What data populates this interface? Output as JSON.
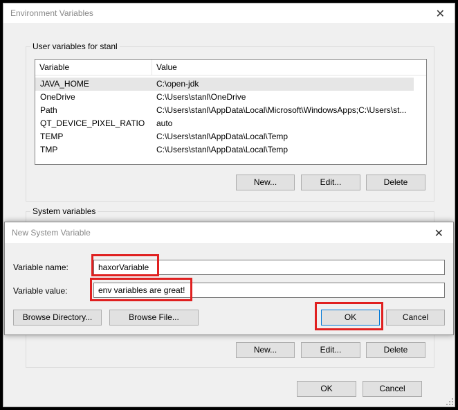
{
  "env_dialog": {
    "title": "Environment Variables",
    "close_glyph": "✕",
    "user_group_label": "User variables for stanl",
    "columns": [
      "Variable",
      "Value"
    ],
    "user_vars": [
      {
        "name": "JAVA_HOME",
        "value": "C:\\open-jdk"
      },
      {
        "name": "OneDrive",
        "value": "C:\\Users\\stanl\\OneDrive"
      },
      {
        "name": "Path",
        "value": "C:\\Users\\stanl\\AppData\\Local\\Microsoft\\WindowsApps;C:\\Users\\st..."
      },
      {
        "name": "QT_DEVICE_PIXEL_RATIO",
        "value": "auto"
      },
      {
        "name": "TEMP",
        "value": "C:\\Users\\stanl\\AppData\\Local\\Temp"
      },
      {
        "name": "TMP",
        "value": "C:\\Users\\stanl\\AppData\\Local\\Temp"
      }
    ],
    "user_buttons": {
      "new": "New...",
      "edit": "Edit...",
      "delete": "Delete"
    },
    "system_group_label": "System variables",
    "system_buttons": {
      "new": "New...",
      "edit": "Edit...",
      "delete": "Delete"
    },
    "ok": "OK",
    "cancel": "Cancel"
  },
  "new_var_dialog": {
    "title": "New System Variable",
    "close_glyph": "✕",
    "name_label": "Variable name:",
    "name_value": "haxorVariable",
    "value_label": "Variable value:",
    "value_value": "env variables are great!",
    "browse_dir": "Browse Directory...",
    "browse_file": "Browse File...",
    "ok": "OK",
    "cancel": "Cancel"
  },
  "colors": {
    "highlight": "#e02020",
    "default_button_border": "#0078d7"
  }
}
